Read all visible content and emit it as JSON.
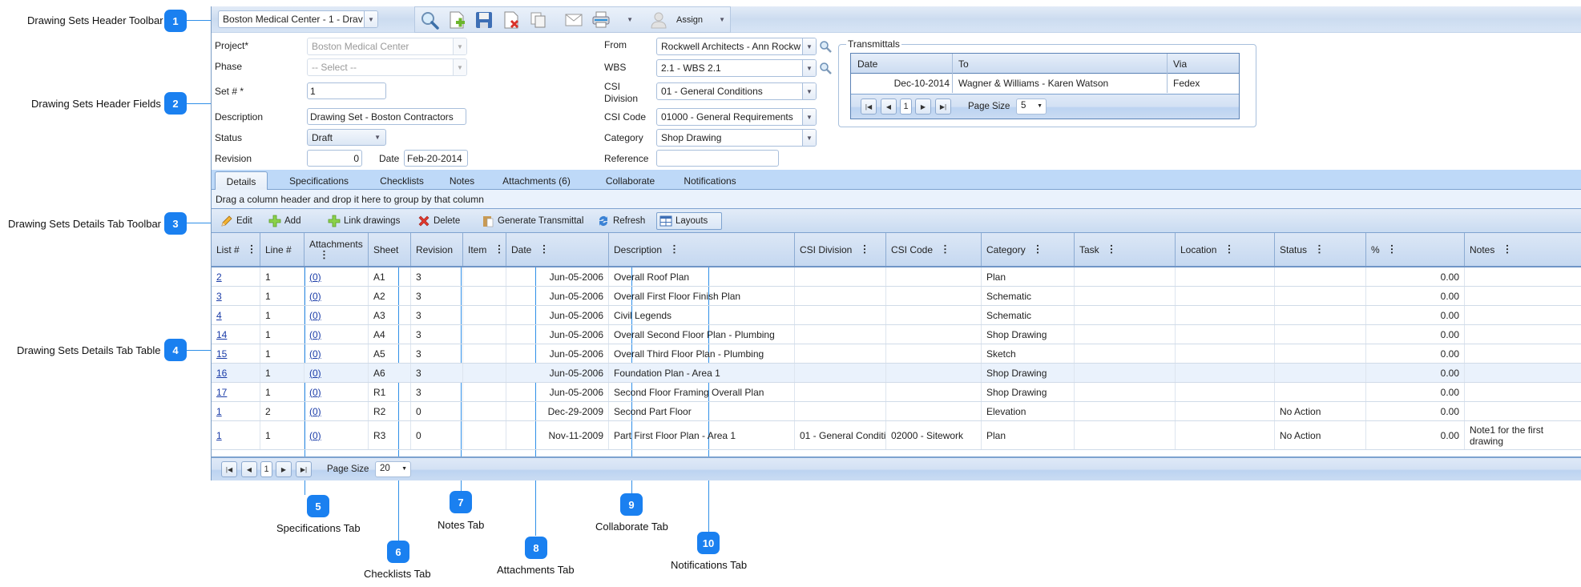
{
  "callouts": [
    {
      "n": "1",
      "label": "Drawing Sets Header Toolbar"
    },
    {
      "n": "2",
      "label": "Drawing Sets Header Fields"
    },
    {
      "n": "3",
      "label": "Drawing Sets Details Tab Toolbar"
    },
    {
      "n": "4",
      "label": "Drawing Sets Details Tab Table"
    },
    {
      "n": "5",
      "label": "Specifications Tab"
    },
    {
      "n": "6",
      "label": "Checklists Tab"
    },
    {
      "n": "7",
      "label": "Notes Tab"
    },
    {
      "n": "8",
      "label": "Attachments Tab"
    },
    {
      "n": "9",
      "label": "Collaborate Tab"
    },
    {
      "n": "10",
      "label": "Notifications Tab"
    }
  ],
  "header_toolbar": {
    "record_selector": "Boston Medical Center - 1 - Drav",
    "icons": [
      "search-icon",
      "new-document-icon",
      "save-icon",
      "delete-document-icon",
      "copy-icon",
      "email-icon",
      "print-icon",
      "user-icon"
    ],
    "assign_label": "Assign"
  },
  "fields": {
    "project": {
      "label": "Project*",
      "value": "Boston Medical Center"
    },
    "phase": {
      "label": "Phase",
      "value": "-- Select --"
    },
    "set_number": {
      "label": "Set # *",
      "value": "1"
    },
    "description": {
      "label": "Description",
      "value": "Drawing Set - Boston Contractors"
    },
    "status": {
      "label": "Status",
      "value": "Draft"
    },
    "revision": {
      "label": "Revision",
      "value": "0"
    },
    "date": {
      "label": "Date",
      "value": "Feb-20-2014"
    },
    "from": {
      "label": "From",
      "value": "Rockwell Architects - Ann Rockw"
    },
    "wbs": {
      "label": "WBS",
      "value": "2.1 - WBS 2.1"
    },
    "csi_division": {
      "label_line1": "CSI",
      "label_line2": "Division",
      "value": "01 - General Conditions"
    },
    "csi_code": {
      "label": "CSI Code",
      "value": "01000 - General Requirements"
    },
    "category": {
      "label": "Category",
      "value": "Shop Drawing"
    },
    "reference": {
      "label": "Reference",
      "value": ""
    }
  },
  "transmittals": {
    "title": "Transmittals",
    "columns": [
      "Date",
      "To",
      "Via"
    ],
    "rows": [
      [
        "Dec-10-2014",
        "Wagner & Williams - Karen Watson",
        "Fedex"
      ]
    ],
    "page": "1",
    "page_size_label": "Page Size",
    "page_size": "5"
  },
  "tabs": [
    {
      "label": "Details",
      "active": true
    },
    {
      "label": "Specifications"
    },
    {
      "label": "Checklists"
    },
    {
      "label": "Notes"
    },
    {
      "label": "Attachments (6)"
    },
    {
      "label": "Collaborate"
    },
    {
      "label": "Notifications"
    }
  ],
  "group_bar_text": "Drag a column header and drop it here to group by that column",
  "details_toolbar": {
    "edit": "Edit",
    "add": "Add",
    "link_drawings": "Link drawings",
    "delete": "Delete",
    "generate_transmittal": "Generate Transmittal",
    "refresh": "Refresh",
    "layouts": "Layouts"
  },
  "table": {
    "columns": [
      "List #",
      "Line #",
      "Attachments",
      "Sheet",
      "Revision",
      "Item",
      "Date",
      "Description",
      "CSI Division",
      "CSI Code",
      "Category",
      "Task",
      "Location",
      "Status",
      "%",
      "Notes"
    ],
    "rows": [
      [
        "2",
        "1",
        "(0)",
        "A1",
        "3",
        "",
        "Jun-05-2006",
        "Overall Roof Plan",
        "",
        "",
        "Plan",
        "",
        "",
        "",
        "0.00",
        ""
      ],
      [
        "3",
        "1",
        "(0)",
        "A2",
        "3",
        "",
        "Jun-05-2006",
        "Overall First Floor Finish Plan",
        "",
        "",
        "Schematic",
        "",
        "",
        "",
        "0.00",
        ""
      ],
      [
        "4",
        "1",
        "(0)",
        "A3",
        "3",
        "",
        "Jun-05-2006",
        "Civil Legends",
        "",
        "",
        "Schematic",
        "",
        "",
        "",
        "0.00",
        ""
      ],
      [
        "14",
        "1",
        "(0)",
        "A4",
        "3",
        "",
        "Jun-05-2006",
        "Overall Second Floor Plan - Plumbing",
        "",
        "",
        "Shop Drawing",
        "",
        "",
        "",
        "0.00",
        ""
      ],
      [
        "15",
        "1",
        "(0)",
        "A5",
        "3",
        "",
        "Jun-05-2006",
        "Overall Third Floor Plan - Plumbing",
        "",
        "",
        "Sketch",
        "",
        "",
        "",
        "0.00",
        ""
      ],
      [
        "16",
        "1",
        "(0)",
        "A6",
        "3",
        "",
        "Jun-05-2006",
        "Foundation Plan - Area 1",
        "",
        "",
        "Shop Drawing",
        "",
        "",
        "",
        "0.00",
        ""
      ],
      [
        "17",
        "1",
        "(0)",
        "R1",
        "3",
        "",
        "Jun-05-2006",
        "Second Floor Framing Overall Plan",
        "",
        "",
        "Shop Drawing",
        "",
        "",
        "",
        "0.00",
        ""
      ],
      [
        "1",
        "2",
        "(0)",
        "R2",
        "0",
        "",
        "Dec-29-2009",
        "Second Part Floor",
        "",
        "",
        "Elevation",
        "",
        "",
        "No Action",
        "0.00",
        ""
      ],
      [
        "1",
        "1",
        "(0)",
        "R3",
        "0",
        "",
        "Nov-11-2009",
        "Part First Floor Plan - Area 1",
        "01 - General Conditi",
        "02000 - Sitework",
        "Plan",
        "",
        "",
        "No Action",
        "0.00",
        "Note1 for the first drawing"
      ]
    ],
    "highlighted_row": 5,
    "page": "1",
    "page_size_label": "Page Size",
    "page_size": "20"
  }
}
